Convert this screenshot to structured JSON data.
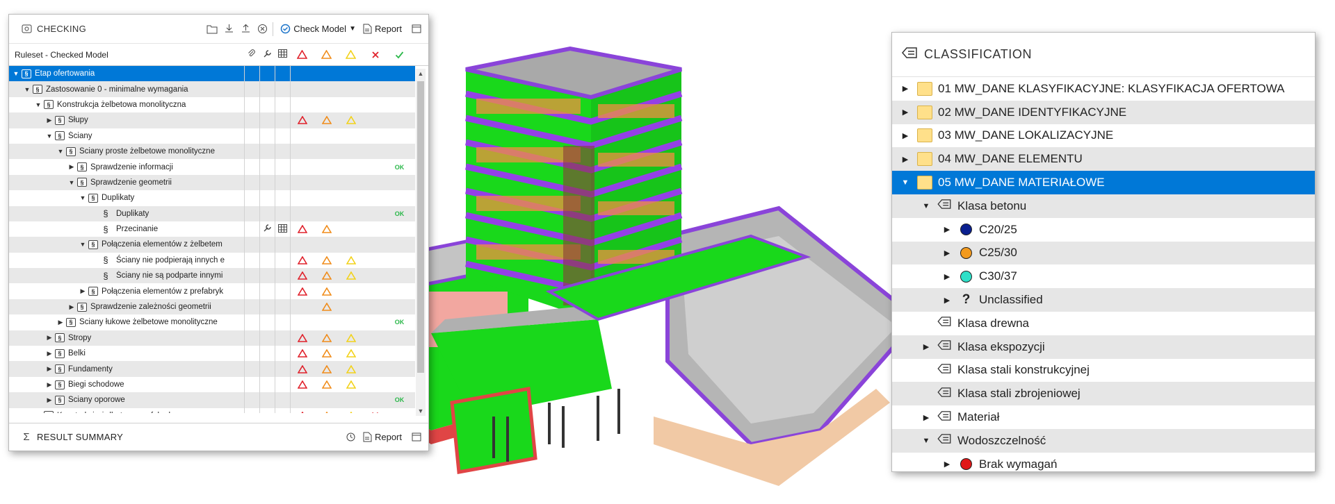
{
  "checking": {
    "title": "CHECKING",
    "toolbar": {
      "check_model_label": "Check Model",
      "report_label": "Report"
    },
    "column_header": "Ruleset - Checked Model",
    "rows": [
      {
        "label": "Etap ofertowania",
        "level": 0,
        "expander": "open",
        "icon": "ruleset",
        "selected": true,
        "err": false,
        "warn_o": false,
        "warn_y": false,
        "ok": false
      },
      {
        "label": "Zastosowanie 0 - minimalne wymagania",
        "level": 1,
        "expander": "open",
        "icon": "ruleset"
      },
      {
        "label": "Konstrukcja żelbetowa monolityczna",
        "level": 2,
        "expander": "open",
        "icon": "ruleset"
      },
      {
        "label": "Słupy",
        "level": 3,
        "expander": "closed",
        "icon": "ruleset",
        "err": true,
        "warn_o": true,
        "warn_y": true
      },
      {
        "label": "Ściany",
        "level": 3,
        "expander": "open",
        "icon": "ruleset"
      },
      {
        "label": "Ściany proste żelbetowe monolityczne",
        "level": 4,
        "expander": "open",
        "icon": "ruleset"
      },
      {
        "label": "Sprawdzenie informacji",
        "level": 5,
        "expander": "closed",
        "icon": "ruleset",
        "ok": true
      },
      {
        "label": "Sprawdzenie geometrii",
        "level": 5,
        "expander": "open",
        "icon": "ruleset"
      },
      {
        "label": "Duplikaty",
        "level": 6,
        "expander": "open",
        "icon": "ruleset"
      },
      {
        "label": "Duplikaty",
        "level": 7,
        "expander": "none",
        "icon": "rule",
        "ok": true
      },
      {
        "label": "Przecinanie",
        "level": 7,
        "expander": "none",
        "icon": "rule",
        "wrench": true,
        "table": true,
        "err": true,
        "warn_o": true
      },
      {
        "label": "Połączenia elementów z żelbetem",
        "level": 6,
        "expander": "open",
        "icon": "ruleset"
      },
      {
        "label": "Ściany nie podpierają innych e",
        "level": 7,
        "expander": "none",
        "icon": "rule",
        "err": true,
        "warn_o": true,
        "warn_y": true
      },
      {
        "label": "Ściany nie są podparte innymi",
        "level": 7,
        "expander": "none",
        "icon": "rule",
        "err": true,
        "warn_o": true,
        "warn_y": true
      },
      {
        "label": "Połączenia elementów z prefabryk",
        "level": 6,
        "expander": "closed",
        "icon": "ruleset",
        "err": true,
        "warn_o": true
      },
      {
        "label": "Sprawdzenie zależności geometrii",
        "level": 5,
        "expander": "closed",
        "icon": "ruleset",
        "warn_o": true
      },
      {
        "label": "Ściany łukowe żelbetowe monolityczne",
        "level": 4,
        "expander": "closed",
        "icon": "ruleset",
        "ok": true
      },
      {
        "label": "Stropy",
        "level": 3,
        "expander": "closed",
        "icon": "ruleset",
        "err": true,
        "warn_o": true,
        "warn_y": true
      },
      {
        "label": "Belki",
        "level": 3,
        "expander": "closed",
        "icon": "ruleset",
        "err": true,
        "warn_o": true,
        "warn_y": true
      },
      {
        "label": "Fundamenty",
        "level": 3,
        "expander": "closed",
        "icon": "ruleset",
        "err": true,
        "warn_o": true,
        "warn_y": true
      },
      {
        "label": "Biegi schodowe",
        "level": 3,
        "expander": "closed",
        "icon": "ruleset",
        "err": true,
        "warn_o": true,
        "warn_y": true
      },
      {
        "label": "Ściany oporowe",
        "level": 3,
        "expander": "closed",
        "icon": "ruleset",
        "ok": true
      },
      {
        "label": "Konstrukcja żelbetowa prefabrykowana",
        "level": 2,
        "expander": "closed",
        "icon": "ruleset",
        "err": true,
        "warn_o": true,
        "warn_y": true,
        "reject": true
      }
    ],
    "ok_text": "OK",
    "footer": {
      "title": "RESULT SUMMARY",
      "report_label": "Report"
    }
  },
  "classification": {
    "title": "CLASSIFICATION",
    "rows": [
      {
        "label": "01 MW_DANE KLASYFIKACYJNE: KLASYFIKACJA OFERTOWA",
        "level": 0,
        "expander": "closed",
        "icon": "folder"
      },
      {
        "label": "02 MW_DANE IDENTYFIKACYJNE",
        "level": 0,
        "expander": "closed",
        "icon": "folder"
      },
      {
        "label": "03 MW_DANE LOKALIZACYJNE",
        "level": 0,
        "expander": "closed",
        "icon": "folder"
      },
      {
        "label": "04 MW_DANE ELEMENTU",
        "level": 0,
        "expander": "closed",
        "icon": "folder"
      },
      {
        "label": "05 MW_DANE MATERIAŁOWE",
        "level": 0,
        "expander": "open",
        "icon": "folder",
        "selected": true
      },
      {
        "label": "Klasa betonu",
        "level": 1,
        "expander": "open",
        "icon": "tag"
      },
      {
        "label": "C20/25",
        "level": 2,
        "expander": "closed",
        "icon": "dot",
        "color": "#0a1f8f"
      },
      {
        "label": "C25/30",
        "level": 2,
        "expander": "closed",
        "icon": "dot",
        "color": "#f39a1e"
      },
      {
        "label": "C30/37",
        "level": 2,
        "expander": "closed",
        "icon": "dot",
        "color": "#2fe0c8"
      },
      {
        "label": "Unclassified",
        "level": 2,
        "expander": "closed",
        "icon": "question"
      },
      {
        "label": "Klasa drewna",
        "level": 1,
        "expander": "none",
        "icon": "tag"
      },
      {
        "label": "Klasa ekspozycji",
        "level": 1,
        "expander": "closed",
        "icon": "tag"
      },
      {
        "label": "Klasa stali konstrukcyjnej",
        "level": 1,
        "expander": "none",
        "icon": "tag"
      },
      {
        "label": "Klasa stali zbrojeniowej",
        "level": 1,
        "expander": "none",
        "icon": "tag"
      },
      {
        "label": "Materiał",
        "level": 1,
        "expander": "closed",
        "icon": "tag"
      },
      {
        "label": "Wodoszczelność",
        "level": 1,
        "expander": "open",
        "icon": "tag"
      },
      {
        "label": "Brak wymagań",
        "level": 2,
        "expander": "closed",
        "icon": "dot",
        "color": "#e01818"
      }
    ]
  },
  "colors": {
    "selection": "#0078d7",
    "error": "#e0202a",
    "warn_orange": "#f08c1a",
    "warn_yellow": "#f2d21a",
    "ok": "#2bb84a",
    "model_green": "#19d81b",
    "model_purple": "#9440e6",
    "model_orange": "#f09040",
    "model_gray": "#a8a8a8"
  }
}
